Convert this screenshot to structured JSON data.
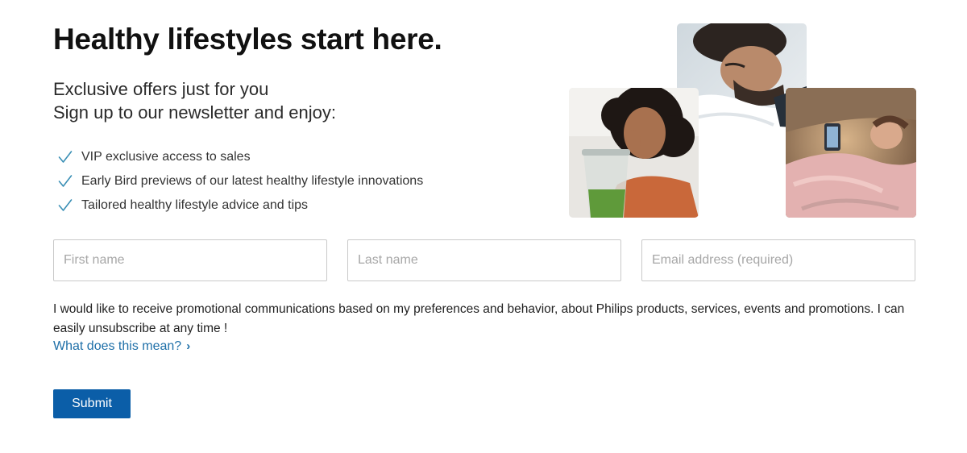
{
  "header": {
    "headline": "Healthy lifestyles start here.",
    "subline_1": "Exclusive offers just for you",
    "subline_2": "Sign up to our newsletter and enjoy:"
  },
  "benefits": [
    {
      "icon": "checkmark-icon",
      "label": "VIP exclusive access to sales"
    },
    {
      "icon": "checkmark-icon",
      "label": "Early Bird previews of our latest healthy lifestyle innovations"
    },
    {
      "icon": "checkmark-icon",
      "label": "Tailored healthy lifestyle advice and tips"
    }
  ],
  "form": {
    "first_name": {
      "value": "",
      "placeholder": "First name"
    },
    "last_name": {
      "value": "",
      "placeholder": "Last name"
    },
    "email": {
      "value": "",
      "placeholder": "Email address (required)"
    },
    "consent_text": "I would like to receive promotional communications based on my preferences and behavior, about Philips products, services, events and promotions. I can easily unsubscribe at any time !",
    "more_link": "What does this mean?",
    "more_link_chevron": "›",
    "submit_label": "Submit"
  },
  "colors": {
    "accent": "#0b5ea8",
    "link": "#1e6fa8",
    "check": "#3a8fb5"
  }
}
